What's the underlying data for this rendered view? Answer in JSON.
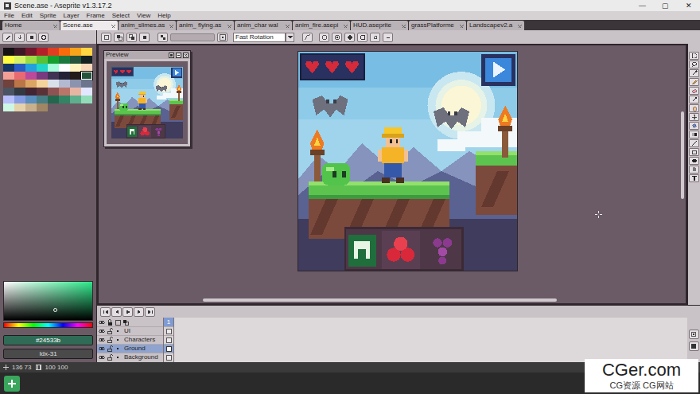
{
  "window": {
    "title": "Scene.ase - Aseprite v1.3.17.2",
    "controls": [
      "—",
      "▢",
      "✕"
    ]
  },
  "menu": [
    "File",
    "Edit",
    "Sprite",
    "Layer",
    "Frame",
    "Select",
    "View",
    "Help"
  ],
  "tabs": [
    {
      "label": "Home",
      "selected": false
    },
    {
      "label": "Scene.ase",
      "selected": true
    },
    {
      "label": "anim_slimes.as",
      "selected": false
    },
    {
      "label": "anim_ flying.as",
      "selected": false
    },
    {
      "label": "anim_char wal",
      "selected": false
    },
    {
      "label": "anim_fire.asepi",
      "selected": false
    },
    {
      "label": "HUD.aseprite",
      "selected": false
    },
    {
      "label": "grassPlatforme",
      "selected": false
    },
    {
      "label": "Landscapev2.a",
      "selected": false
    }
  ],
  "context_bar": {
    "rotation_algorithm": "Fast Rotation"
  },
  "palette": [
    {
      "color": "#141013",
      "selected": false
    },
    {
      "color": "#3b1725",
      "selected": false
    },
    {
      "color": "#73172d",
      "selected": false
    },
    {
      "color": "#b4202a",
      "selected": false
    },
    {
      "color": "#df3e23",
      "selected": false
    },
    {
      "color": "#fa6a0a",
      "selected": false
    },
    {
      "color": "#f9a31b",
      "selected": false
    },
    {
      "color": "#ffd541",
      "selected": false
    },
    {
      "color": "#fffc40",
      "selected": false
    },
    {
      "color": "#d6f264",
      "selected": false
    },
    {
      "color": "#9cdb43",
      "selected": false
    },
    {
      "color": "#59c135",
      "selected": false
    },
    {
      "color": "#14a02e",
      "selected": false
    },
    {
      "color": "#1a7a3e",
      "selected": false
    },
    {
      "color": "#24523b",
      "selected": false
    },
    {
      "color": "#122020",
      "selected": false
    },
    {
      "color": "#143464",
      "selected": false
    },
    {
      "color": "#285cc4",
      "selected": false
    },
    {
      "color": "#249fde",
      "selected": false
    },
    {
      "color": "#20d6c7",
      "selected": false
    },
    {
      "color": "#a6fcdb",
      "selected": false
    },
    {
      "color": "#ffffff",
      "selected": false
    },
    {
      "color": "#fef3c0",
      "selected": false
    },
    {
      "color": "#fad6b8",
      "selected": false
    },
    {
      "color": "#f5a097",
      "selected": false
    },
    {
      "color": "#e86a73",
      "selected": false
    },
    {
      "color": "#bc4a9b",
      "selected": false
    },
    {
      "color": "#793a80",
      "selected": false
    },
    {
      "color": "#403353",
      "selected": false
    },
    {
      "color": "#242234",
      "selected": false
    },
    {
      "color": "#221c1a",
      "selected": false
    },
    {
      "color": "#24533b",
      "selected": true
    },
    {
      "color": "#71413b",
      "selected": false
    },
    {
      "color": "#bb7547",
      "selected": false
    },
    {
      "color": "#dba463",
      "selected": false
    },
    {
      "color": "#f4d29c",
      "selected": false
    },
    {
      "color": "#dae0ea",
      "selected": false
    },
    {
      "color": "#b3b9d1",
      "selected": false
    },
    {
      "color": "#8b93af",
      "selected": false
    },
    {
      "color": "#6d758d",
      "selected": false
    },
    {
      "color": "#4a5462",
      "selected": false
    },
    {
      "color": "#333941",
      "selected": false
    },
    {
      "color": "#422433",
      "selected": false
    },
    {
      "color": "#5b3138",
      "selected": false
    },
    {
      "color": "#8e5252",
      "selected": false
    },
    {
      "color": "#ba756a",
      "selected": false
    },
    {
      "color": "#e9b5a3",
      "selected": false
    },
    {
      "color": "#e3e6ff",
      "selected": false
    },
    {
      "color": "#b9bffb",
      "selected": false
    },
    {
      "color": "#849be4",
      "selected": false
    },
    {
      "color": "#588dbe",
      "selected": false
    },
    {
      "color": "#477d85",
      "selected": false
    },
    {
      "color": "#23674e",
      "selected": false
    },
    {
      "color": "#328464",
      "selected": false
    },
    {
      "color": "#5daf8d",
      "selected": false
    },
    {
      "color": "#92dcba",
      "selected": false
    },
    {
      "color": "#cdf7e2",
      "selected": false
    },
    {
      "color": "#e4d2aa",
      "selected": false
    },
    {
      "color": "#c7b08b",
      "selected": false
    },
    {
      "color": "#a08662",
      "selected": false
    }
  ],
  "color_bar": {
    "hex": "#24533b",
    "index": "Idx-31"
  },
  "preview": {
    "title": "Preview"
  },
  "timeline": {
    "frames": [
      {
        "label": "1",
        "selected": true
      }
    ],
    "layers": [
      {
        "name": "UI",
        "visible": true,
        "locked": false,
        "selected": false
      },
      {
        "name": "Characters",
        "visible": true,
        "locked": false,
        "selected": false
      },
      {
        "name": "Ground",
        "visible": true,
        "locked": false,
        "selected": true
      },
      {
        "name": "Background",
        "visible": true,
        "locked": false,
        "selected": false
      }
    ]
  },
  "status_bar": {
    "position": "136 73",
    "size": "100 100"
  },
  "watermark": {
    "brand": "CGer.com",
    "subtitle": "CG资源 CG网站"
  }
}
